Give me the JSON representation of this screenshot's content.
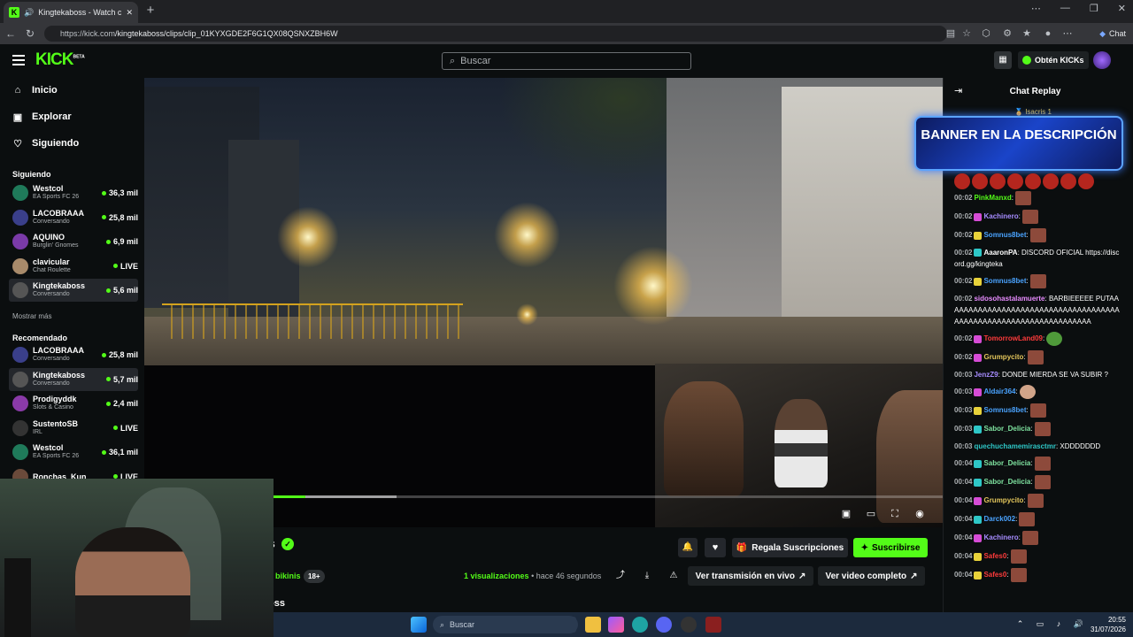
{
  "browser": {
    "tab_title": "Kingtekaboss - Watch clips o",
    "tab_favicon": "K",
    "url_host": "https://kick.com",
    "url_path": "/kingtekaboss/clips/clip_01KYXGDE2F6G1QX08QSNXZBH6W",
    "chat_button": "Chat",
    "new_tab": "+"
  },
  "header": {
    "logo": "KICK",
    "logo_badge": "BETA",
    "search_placeholder": "Buscar",
    "kicks_button": "Obtén KICKs"
  },
  "sidebar": {
    "nav": [
      {
        "label": "Inicio",
        "icon": "home-icon"
      },
      {
        "label": "Explorar",
        "icon": "browse-icon"
      },
      {
        "label": "Siguiendo",
        "icon": "heart-icon"
      }
    ],
    "following_title": "Siguiendo",
    "following": [
      {
        "name": "Westcol",
        "category": "EA Sports FC 26",
        "viewers": "36,3 mil",
        "color": "#1f7a5a"
      },
      {
        "name": "LACOBRAAA",
        "category": "Conversando",
        "viewers": "25,8 mil",
        "color": "#3a3f8a"
      },
      {
        "name": "AQUINO",
        "category": "Burglin' Gnomes",
        "viewers": "6,9 mil",
        "color": "#7a3aa8"
      },
      {
        "name": "clavicular",
        "category": "Chat Roulette",
        "viewers": "LIVE",
        "color": "#a88a6a"
      },
      {
        "name": "Kingtekaboss",
        "category": "Conversando",
        "viewers": "5,6 mil",
        "color": "#555"
      }
    ],
    "show_more": "Mostrar más",
    "recommended_title": "Recomendado",
    "recommended": [
      {
        "name": "LACOBRAAA",
        "category": "Conversando",
        "viewers": "25,8 mil",
        "color": "#3a3f8a"
      },
      {
        "name": "Kingtekaboss",
        "category": "Conversando",
        "viewers": "5,7 mil",
        "color": "#555"
      },
      {
        "name": "Prodigyddk",
        "category": "Slots & Casino",
        "viewers": "2,4 mil",
        "color": "#8a3aa8"
      },
      {
        "name": "SustentoSB",
        "category": "IRL",
        "viewers": "LIVE",
        "color": "#333"
      },
      {
        "name": "Westcol",
        "category": "EA Sports FC 26",
        "viewers": "36,1 mil",
        "color": "#1f7a5a"
      },
      {
        "name": "Ronchas_Kun",
        "category": "",
        "viewers": "LIVE",
        "color": "#6a4a3a"
      }
    ]
  },
  "player": {
    "progress_fraction": 0.055,
    "buffered_fraction": 0.19
  },
  "clip_info": {
    "channel_name_partial": "s",
    "tag": "bikinis",
    "age_badge": "18+",
    "views": "1 visualizaciones",
    "time_ago": "• hace 46 segundos",
    "gift_button": "Regala Suscripciones",
    "subscribe_button": "Suscribirse",
    "live_button": "Ver transmisión en vivo",
    "full_video_button": "Ver video completo",
    "bottom_partial": "oss"
  },
  "chat": {
    "title": "Chat Replay",
    "pinned_user": "Isacris 1",
    "banner_text": "BANNER EN LA DESCRIPCIÓN",
    "messages": [
      {
        "ts": "00:02",
        "user": "PinkManxd",
        "color": "#53fc18",
        "badge": "",
        "text": "",
        "emote": "emo"
      },
      {
        "ts": "00:02",
        "user": "Kachinero",
        "color": "#a68cff",
        "badge": "#d64cd6",
        "text": "",
        "emote": "emo"
      },
      {
        "ts": "00:02",
        "user": "Somnus8bet",
        "color": "#4aa3ff",
        "badge": "#e8d23a",
        "text": "",
        "emote": "emo"
      },
      {
        "ts": "00:02",
        "user": "AaaronPA",
        "color": "#fff",
        "badge": "#2ec7c7",
        "text": "DISCORD OFICIAL https://discord.gg/kingteka",
        "emote": ""
      },
      {
        "ts": "00:02",
        "user": "Somnus8bet",
        "color": "#4aa3ff",
        "badge": "#e8d23a",
        "text": "",
        "emote": "emo"
      },
      {
        "ts": "00:02",
        "user": "sidosohastalamuerte",
        "color": "#e88cff",
        "badge": "",
        "text": "BARBIEEEEE PUTAAAAAAAAAAAAAAAAAAAAAAAAAAAAAAAAAAAAAAAAAAAAAAAAAAAAAAAAAAAAAAAAAA",
        "emote": ""
      },
      {
        "ts": "00:02",
        "user": "TomorrowLand09",
        "color": "#ff3b3b",
        "badge": "#d64cd6",
        "text": "",
        "emote": "pepe"
      },
      {
        "ts": "00:02",
        "user": "Grumpycito",
        "color": "#e2c55b",
        "badge": "#d64cd6",
        "text": "",
        "emote": "emo"
      },
      {
        "ts": "00:03",
        "user": "JenzZ9",
        "color": "#a68cff",
        "badge": "",
        "text": "DONDE MIERDA SE VA SUBIR ?",
        "emote": ""
      },
      {
        "ts": "00:03",
        "user": "Aldair364",
        "color": "#4aa3ff",
        "badge": "#d64cd6",
        "text": "",
        "emote": "face"
      },
      {
        "ts": "00:03",
        "user": "Somnus8bet",
        "color": "#4aa3ff",
        "badge": "#e8d23a",
        "text": "",
        "emote": "emo"
      },
      {
        "ts": "00:03",
        "user": "Sabor_Delicia",
        "color": "#7fe3a0",
        "badge": "#2ec7c7",
        "text": "",
        "emote": "emo"
      },
      {
        "ts": "00:03",
        "user": "quechuchamemirasctmr",
        "color": "#2ec7c7",
        "badge": "",
        "text": "XDDDDDDD",
        "emote": ""
      },
      {
        "ts": "00:04",
        "user": "Sabor_Delicia",
        "color": "#7fe3a0",
        "badge": "#2ec7c7",
        "text": "",
        "emote": "emo"
      },
      {
        "ts": "00:04",
        "user": "Sabor_Delicia",
        "color": "#7fe3a0",
        "badge": "#2ec7c7",
        "text": "",
        "emote": "emo"
      },
      {
        "ts": "00:04",
        "user": "Grumpycito",
        "color": "#e2c55b",
        "badge": "#d64cd6",
        "text": "",
        "emote": "emo"
      },
      {
        "ts": "00:04",
        "user": "Darck002",
        "color": "#4aa3ff",
        "badge": "#2ec7c7",
        "text": "",
        "emote": "emo"
      },
      {
        "ts": "00:04",
        "user": "Kachinero",
        "color": "#a68cff",
        "badge": "#d64cd6",
        "text": "",
        "emote": "emo"
      },
      {
        "ts": "00:04",
        "user": "Safes0",
        "color": "#ff3b3b",
        "badge": "#e8d23a",
        "text": "",
        "emote": "emo"
      },
      {
        "ts": "00:04",
        "user": "Safes0",
        "color": "#ff3b3b",
        "badge": "#e8d23a",
        "text": "",
        "emote": "emo"
      }
    ]
  },
  "taskbar": {
    "search": "Buscar",
    "time": "20:55",
    "date": "31/07/2026"
  },
  "colors": {
    "accent": "#53fc18",
    "background": "#0b0e0f"
  }
}
